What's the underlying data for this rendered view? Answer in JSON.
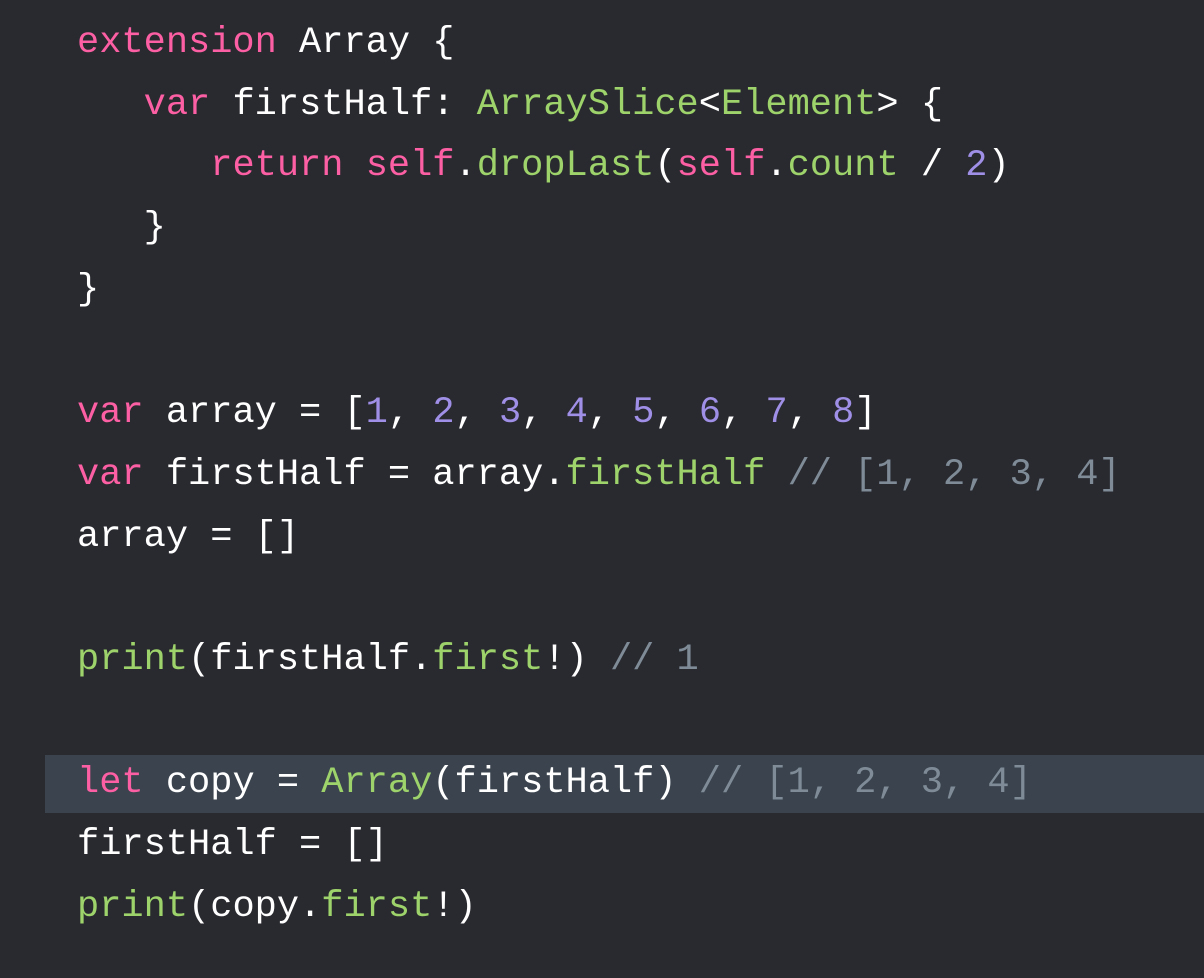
{
  "colors": {
    "background": "#292a30",
    "highlight": "#3a434e",
    "keyword": "#fc5fa3",
    "type_or_member": "#9dd36a",
    "number": "#a08fe6",
    "comment": "#7f8c98",
    "plain": "#ffffff"
  },
  "highlighted_line": 12,
  "lines": [
    [
      {
        "c": "kw",
        "t": "extension"
      },
      {
        "c": "pl",
        "t": " Array {"
      }
    ],
    [
      {
        "c": "pl",
        "t": "   "
      },
      {
        "c": "kw",
        "t": "var"
      },
      {
        "c": "pl",
        "t": " firstHalf: "
      },
      {
        "c": "fn",
        "t": "ArraySlice"
      },
      {
        "c": "pl",
        "t": "<"
      },
      {
        "c": "fn",
        "t": "Element"
      },
      {
        "c": "pl",
        "t": "> {"
      }
    ],
    [
      {
        "c": "pl",
        "t": "      "
      },
      {
        "c": "kw",
        "t": "return"
      },
      {
        "c": "pl",
        "t": " "
      },
      {
        "c": "kw",
        "t": "self"
      },
      {
        "c": "pl",
        "t": "."
      },
      {
        "c": "fn",
        "t": "dropLast"
      },
      {
        "c": "pl",
        "t": "("
      },
      {
        "c": "kw",
        "t": "self"
      },
      {
        "c": "pl",
        "t": "."
      },
      {
        "c": "fn",
        "t": "count"
      },
      {
        "c": "pl",
        "t": " / "
      },
      {
        "c": "num",
        "t": "2"
      },
      {
        "c": "pl",
        "t": ")"
      }
    ],
    [
      {
        "c": "pl",
        "t": "   }"
      }
    ],
    [
      {
        "c": "pl",
        "t": "}"
      }
    ],
    [],
    [
      {
        "c": "kw",
        "t": "var"
      },
      {
        "c": "pl",
        "t": " array = ["
      },
      {
        "c": "num",
        "t": "1"
      },
      {
        "c": "pl",
        "t": ", "
      },
      {
        "c": "num",
        "t": "2"
      },
      {
        "c": "pl",
        "t": ", "
      },
      {
        "c": "num",
        "t": "3"
      },
      {
        "c": "pl",
        "t": ", "
      },
      {
        "c": "num",
        "t": "4"
      },
      {
        "c": "pl",
        "t": ", "
      },
      {
        "c": "num",
        "t": "5"
      },
      {
        "c": "pl",
        "t": ", "
      },
      {
        "c": "num",
        "t": "6"
      },
      {
        "c": "pl",
        "t": ", "
      },
      {
        "c": "num",
        "t": "7"
      },
      {
        "c": "pl",
        "t": ", "
      },
      {
        "c": "num",
        "t": "8"
      },
      {
        "c": "pl",
        "t": "]"
      }
    ],
    [
      {
        "c": "kw",
        "t": "var"
      },
      {
        "c": "pl",
        "t": " firstHalf = array."
      },
      {
        "c": "fn",
        "t": "firstHalf"
      },
      {
        "c": "pl",
        "t": " "
      },
      {
        "c": "cm",
        "t": "// [1, 2, 3, 4]"
      }
    ],
    [
      {
        "c": "pl",
        "t": "array = []"
      }
    ],
    [],
    [
      {
        "c": "fn",
        "t": "print"
      },
      {
        "c": "pl",
        "t": "(firstHalf."
      },
      {
        "c": "fn",
        "t": "first"
      },
      {
        "c": "pl",
        "t": "!) "
      },
      {
        "c": "cm",
        "t": "// 1"
      }
    ],
    [],
    [
      {
        "c": "kw",
        "t": "let"
      },
      {
        "c": "pl",
        "t": " copy = "
      },
      {
        "c": "fn",
        "t": "Array"
      },
      {
        "c": "pl",
        "t": "(firstHalf) "
      },
      {
        "c": "cm",
        "t": "// [1, 2, 3, 4]"
      }
    ],
    [
      {
        "c": "pl",
        "t": "firstHalf = []"
      }
    ],
    [
      {
        "c": "fn",
        "t": "print"
      },
      {
        "c": "pl",
        "t": "(copy."
      },
      {
        "c": "fn",
        "t": "first"
      },
      {
        "c": "pl",
        "t": "!)"
      }
    ]
  ]
}
